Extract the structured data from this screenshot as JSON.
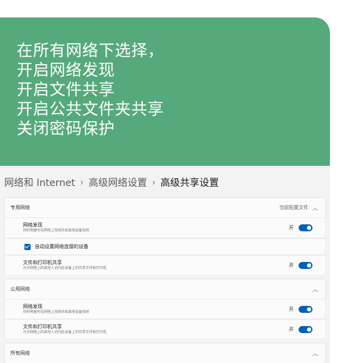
{
  "banner": {
    "lines": [
      "在所有网络下选择，",
      "开启网络发现",
      "开启文件共享",
      "开启公共文件夹共享",
      "关闭密码保护"
    ]
  },
  "breadcrumb": {
    "items": [
      "网络和 Internet",
      "高级网络设置"
    ],
    "separator": "›",
    "current": "高级共享设置"
  },
  "private_network": {
    "title": "专用网络",
    "status": "当前配置文件",
    "discovery": {
      "title": "网络发现",
      "desc": "你的电脑可在网络上找到并由其他设备找到",
      "state": "开"
    },
    "auto_setup": {
      "label": "自动设置网络连接的设备",
      "checked": true
    },
    "file_sharing": {
      "title": "文件和打印机共享",
      "desc": "允许网络上的其他人访问此设备上的共享文件和打印机",
      "state": "开"
    }
  },
  "public_network": {
    "title": "公用网络",
    "discovery": {
      "title": "网络发现",
      "desc": "你的电脑可在网络上找到并由其他设备找到",
      "state": "开"
    },
    "file_sharing": {
      "title": "文件和打印机共享",
      "desc": "允许网络上的其他人访问此设备上的共享文件和打印机",
      "state": "开"
    }
  },
  "all_networks": {
    "title": "所有网络"
  },
  "colors": {
    "banner": "#55a97b",
    "accent": "#005fb8",
    "background": "#f3f3f3"
  }
}
